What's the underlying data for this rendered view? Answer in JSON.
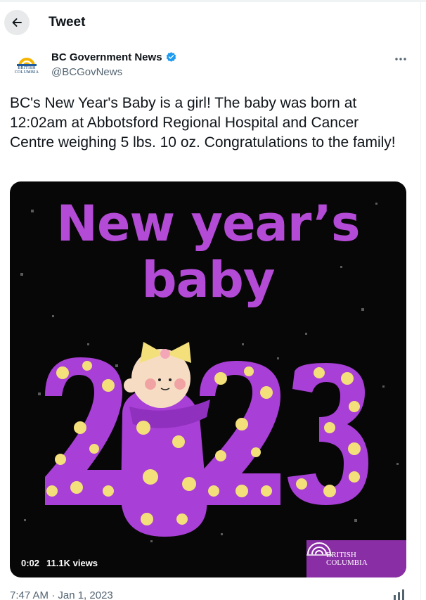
{
  "header": {
    "title": "Tweet"
  },
  "author": {
    "name": "BC Government News",
    "handle": "@BCGovNews",
    "avatar_text_line1": "BRITISH",
    "avatar_text_line2": "COLUMBIA"
  },
  "tweet": {
    "text": "BC's New Year's Baby is a girl! The baby was born at 12:02am at Abbotsford Regional Hospital and Cancer Centre weighing 5 lbs. 10 oz. Congratulations to the family!",
    "timestamp": "7:47 AM · Jan 1, 2023"
  },
  "media": {
    "headline_line1": "New year’s",
    "headline_line2": "baby",
    "year_text": "2023",
    "video_time": "0:02",
    "views": "11.1K views",
    "logo_line1": "BRITISH",
    "logo_line2": "COLUMBIA"
  },
  "colors": {
    "accent_purple": "#b44bd6",
    "polka_yellow": "#f3e07a",
    "verified_blue": "#1d9bf0",
    "muted_text": "#536471"
  },
  "icons": {
    "back": "arrow-left-icon",
    "verified": "verified-badge-icon",
    "more": "more-dots-icon",
    "analytics": "analytics-icon"
  }
}
